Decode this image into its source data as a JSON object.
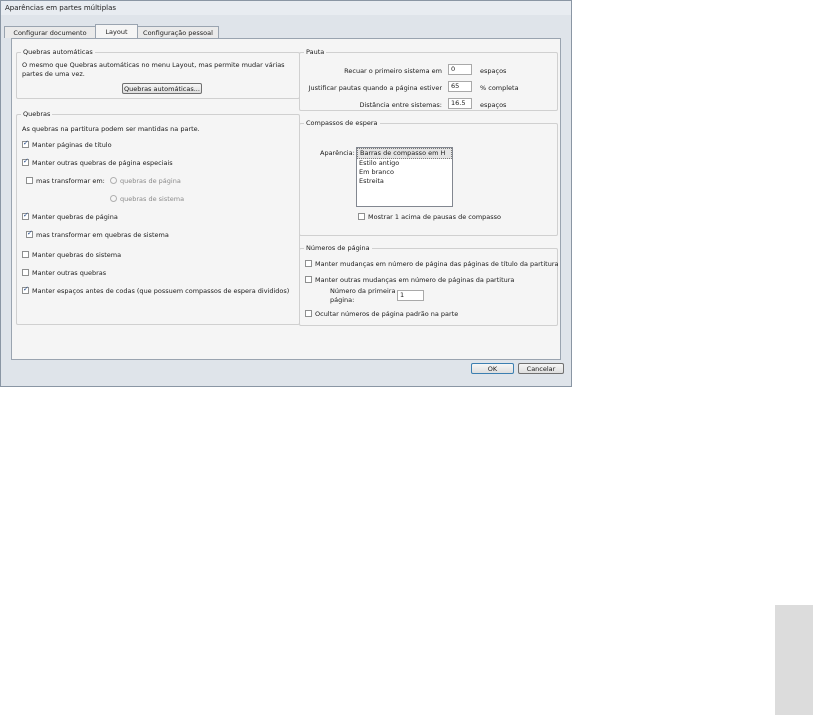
{
  "window": {
    "title": "Aparências em partes múltiplas"
  },
  "tabs": [
    {
      "label": "Configurar documento"
    },
    {
      "label": "Layout"
    },
    {
      "label": "Configuração pessoal"
    }
  ],
  "auto_breaks": {
    "legend": "Quebras automáticas",
    "description": "O mesmo que Quebras automáticas no menu Layout, mas permite mudar várias partes de uma vez.",
    "button": "Quebras automáticas..."
  },
  "breaks": {
    "legend": "Quebras",
    "intro": "As quebras na partitura podem ser mantidas na parte.",
    "keep_title_pages": "Manter páginas de título",
    "keep_special_page_breaks": "Manter outras quebras de página especiais",
    "but_transform_into": "mas transformar em:",
    "radio_page_breaks": "quebras de página",
    "radio_system_breaks": "quebras de sistema",
    "keep_page_breaks": "Manter quebras de página",
    "transform_to_system_breaks": "mas transformar em quebras de sistema",
    "keep_system_breaks": "Manter quebras do sistema",
    "keep_other_breaks": "Manter outras quebras",
    "keep_spaces_before_codas": "Manter espaços antes de codas (que possuem compassos de espera divididos)"
  },
  "staff": {
    "legend": "Pauta",
    "indent_label": "Recuar o primeiro sistema em",
    "indent_value": "0",
    "indent_unit": "espaços",
    "justify_label": "Justificar pautas quando a página estiver",
    "justify_value": "65",
    "justify_unit": "% completa",
    "distance_label": "Distância entre sistemas:",
    "distance_value": "16.5",
    "distance_unit": "espaços"
  },
  "multirests": {
    "legend": "Compassos de espera",
    "appearance_label": "Aparência:",
    "options": [
      "Barras de compasso em H",
      "Estilo antigo",
      "Em branco",
      "Estreita"
    ],
    "show_one_above": "Mostrar 1 acima de pausas de compasso"
  },
  "page_numbers": {
    "legend": "Números de página",
    "keep_title_changes": "Manter mudanças em número de página das páginas de título da partitura",
    "keep_other_changes": "Manter outras mudanças em número de páginas da partitura",
    "first_page_label_1": "Número da primeira",
    "first_page_label_2": "página:",
    "first_page_value": "1",
    "hide_default": "Ocultar números de página padrão na parte"
  },
  "footer": {
    "ok": "OK",
    "cancel": "Cancelar"
  }
}
